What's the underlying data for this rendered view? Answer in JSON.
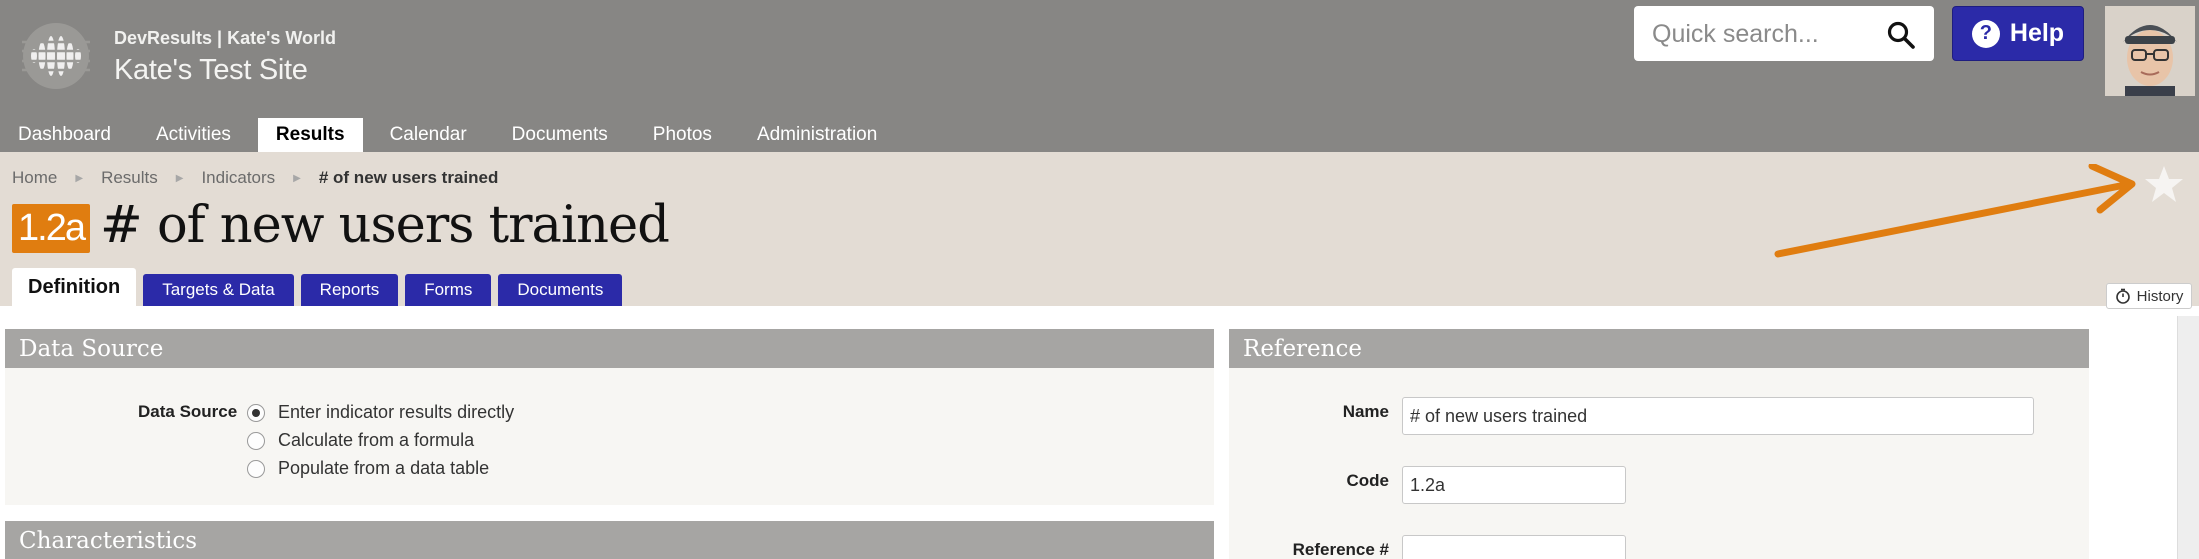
{
  "header": {
    "org_line": "DevResults | Kate's World",
    "site_title": "Kate's Test Site",
    "search_placeholder": "Quick search...",
    "help_label": "Help",
    "help_icon_glyph": "?"
  },
  "nav": {
    "items": [
      {
        "label": "Dashboard"
      },
      {
        "label": "Activities"
      },
      {
        "label": "Results",
        "active": true
      },
      {
        "label": "Calendar"
      },
      {
        "label": "Documents"
      },
      {
        "label": "Photos"
      },
      {
        "label": "Administration"
      }
    ]
  },
  "breadcrumb": [
    "Home",
    "Results",
    "Indicators",
    "# of new users trained"
  ],
  "indicator": {
    "code": "1.2a",
    "title": "# of new users trained"
  },
  "tabs": [
    "Definition",
    "Targets & Data",
    "Reports",
    "Forms",
    "Documents"
  ],
  "history_label": "History",
  "data_source": {
    "heading": "Data Source",
    "label": "Data Source",
    "options": [
      {
        "label": "Enter indicator results directly",
        "selected": true
      },
      {
        "label": "Calculate from a formula",
        "selected": false
      },
      {
        "label": "Populate from a data table",
        "selected": false
      }
    ]
  },
  "characteristics": {
    "heading": "Characteristics"
  },
  "reference": {
    "heading": "Reference",
    "name_label": "Name",
    "name_value": "# of new users trained",
    "code_label": "Code",
    "code_value": "1.2a",
    "ref_label": "Reference #",
    "ref_value": ""
  },
  "colors": {
    "header_bg": "#878684",
    "brand_blue": "#2b2aa8",
    "badge_orange": "#e07d10",
    "indicator_bg": "#e3dcd4"
  }
}
